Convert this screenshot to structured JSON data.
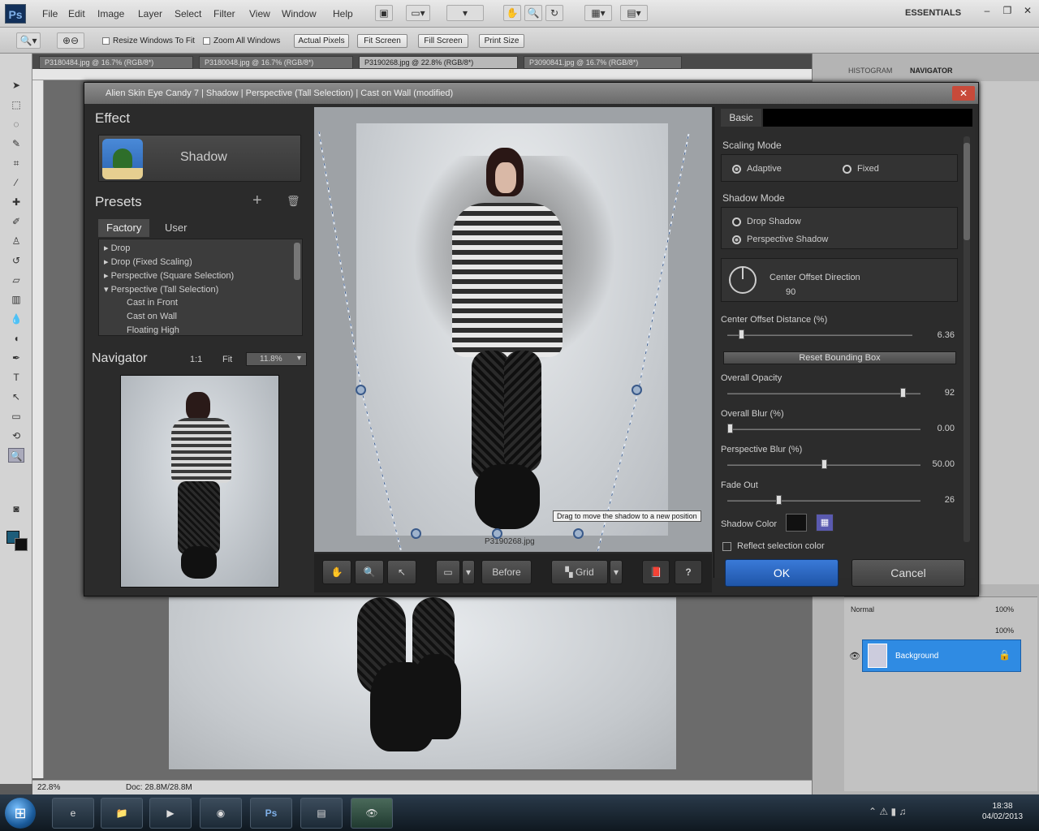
{
  "menu": [
    "File",
    "Edit",
    "Image",
    "Layer",
    "Select",
    "Filter",
    "View",
    "Window",
    "Help"
  ],
  "workspace": "ESSENTIALS",
  "options": {
    "resize_windows": "Resize Windows To Fit",
    "zoom_all": "Zoom All Windows",
    "actual_pixels": "Actual Pixels",
    "fit_screen": "Fit Screen",
    "fill_screen": "Fill Screen",
    "print_size": "Print Size"
  },
  "doc_tabs": [
    "P3180484.jpg @ 16.7% (RGB/8*)",
    "P3180048.jpg @ 16.7% (RGB/8*)",
    "P3190268.jpg @ 22.8% (RGB/8*)",
    "P3090841.jpg @ 16.7% (RGB/8*)"
  ],
  "status": {
    "zoom": "22.8%",
    "doc": "Doc: 28.8M/28.8M"
  },
  "panels": {
    "navigator_tab": "NAVIGATOR",
    "histogram_tab": "HISTOGRAM",
    "layer_name": "Background",
    "blend": "Normal",
    "opacity": "100%",
    "fill": "100%"
  },
  "taskbar": {
    "time": "18:38",
    "date": "04/02/2013"
  },
  "dialog": {
    "title": "Alien Skin Eye Candy 7 | Shadow | Perspective (Tall Selection) | Cast on Wall (modified)",
    "close": "✕",
    "effect_heading": "Effect",
    "effect_name": "Shadow",
    "presets_heading": "Presets",
    "preset_tabs": [
      "Factory",
      "User"
    ],
    "preset_items": [
      "Drop",
      "Drop (Fixed Scaling)",
      "Perspective (Square Selection)",
      "Perspective (Tall Selection)",
      "Cast in Front",
      "Cast on Wall",
      "Floating High"
    ],
    "navigator_heading": "Navigator",
    "nav_1to1": "1:1",
    "nav_fit": "Fit",
    "nav_zoom": "11.8%",
    "preview_caption": "P3190268.jpg",
    "tooltip": "Drag to move the shadow to a new position",
    "toolbar": {
      "before": "Before",
      "grid": "Grid",
      "help": "?"
    },
    "settings": {
      "tab": "Basic",
      "scaling_mode": "Scaling Mode",
      "adaptive": "Adaptive",
      "fixed": "Fixed",
      "shadow_mode": "Shadow Mode",
      "drop_shadow": "Drop Shadow",
      "perspective_shadow": "Perspective Shadow",
      "center_offset_direction": "Center Offset Direction",
      "direction_value": "90",
      "center_offset_distance_label": "Center Offset Distance (%)",
      "center_offset_distance_value": "6.36",
      "reset": "Reset Bounding Box",
      "overall_opacity_label": "Overall Opacity",
      "overall_opacity_value": "92",
      "overall_blur_label": "Overall Blur (%)",
      "overall_blur_value": "0.00",
      "perspective_blur_label": "Perspective Blur (%)",
      "perspective_blur_value": "50.00",
      "fade_out_label": "Fade Out",
      "fade_out_value": "26",
      "shadow_color_label": "Shadow Color",
      "reflect_selection_color": "Reflect selection color"
    },
    "ok": "OK",
    "cancel": "Cancel"
  },
  "sliders": {
    "center_offset_distance": 0.06,
    "overall_opacity": 0.92,
    "overall_blur": 0.0,
    "perspective_blur": 0.5,
    "fade_out": 0.26
  },
  "colors": {
    "ok_button": "#2a66c4",
    "layer_selected": "#2f8be3"
  }
}
